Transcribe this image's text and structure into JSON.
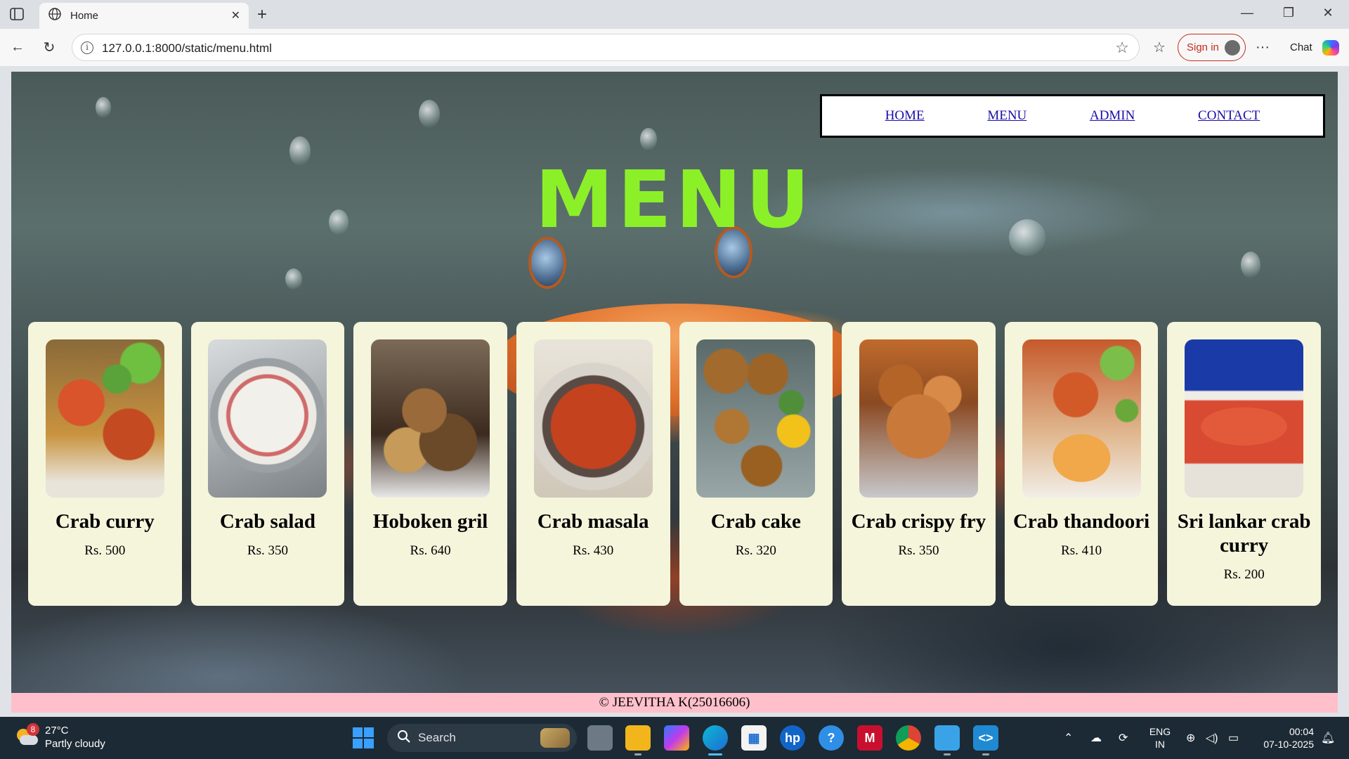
{
  "browser": {
    "tab_title": "Home",
    "address": "127.0.0.1:8000/static/menu.html",
    "signin_label": "Sign in",
    "chat_label": "Chat"
  },
  "nav": {
    "links": [
      "HOME",
      "MENU",
      "ADMIN",
      "CONTACT"
    ]
  },
  "page": {
    "title": "MENU",
    "title_color": "#8cf029",
    "card_bg": "#f5f5dc",
    "footer_bg": "#ffc0cb",
    "footer": "© JEEVITHA K(25016606)"
  },
  "menu_items": [
    {
      "name": "Crab curry",
      "price": "Rs. 500"
    },
    {
      "name": "Crab salad",
      "price": "Rs. 350"
    },
    {
      "name": "Hoboken gril",
      "price": "Rs. 640"
    },
    {
      "name": "Crab masala",
      "price": "Rs. 430"
    },
    {
      "name": "Crab cake",
      "price": "Rs. 320"
    },
    {
      "name": "Crab crispy fry",
      "price": "Rs. 350"
    },
    {
      "name": "Crab thandoori",
      "price": "Rs. 410"
    },
    {
      "name": "Sri lankar crab curry",
      "price": "Rs. 200"
    }
  ],
  "taskbar": {
    "weather_badge": "8",
    "temperature": "27°C",
    "condition": "Partly cloudy",
    "search_label": "Search",
    "lang_line1": "ENG",
    "lang_line2": "IN",
    "time": "00:04",
    "date": "07-10-2025"
  },
  "icons": {
    "browser": [
      "sidebar-icon",
      "globe-icon",
      "close-icon",
      "plus-icon",
      "minimize-icon",
      "restore-icon",
      "close-window-icon",
      "back-icon",
      "refresh-icon",
      "info-icon",
      "star-icon",
      "favorites-icon",
      "more-icon",
      "copilot-icon"
    ],
    "taskbar": [
      "windows-start-icon",
      "search-icon",
      "task-view-icon",
      "file-explorer-icon",
      "copilot-icon",
      "edge-icon",
      "store-icon",
      "hp-icon",
      "help-icon",
      "mcafee-icon",
      "chrome-icon",
      "notepad-icon",
      "vscode-icon"
    ]
  }
}
